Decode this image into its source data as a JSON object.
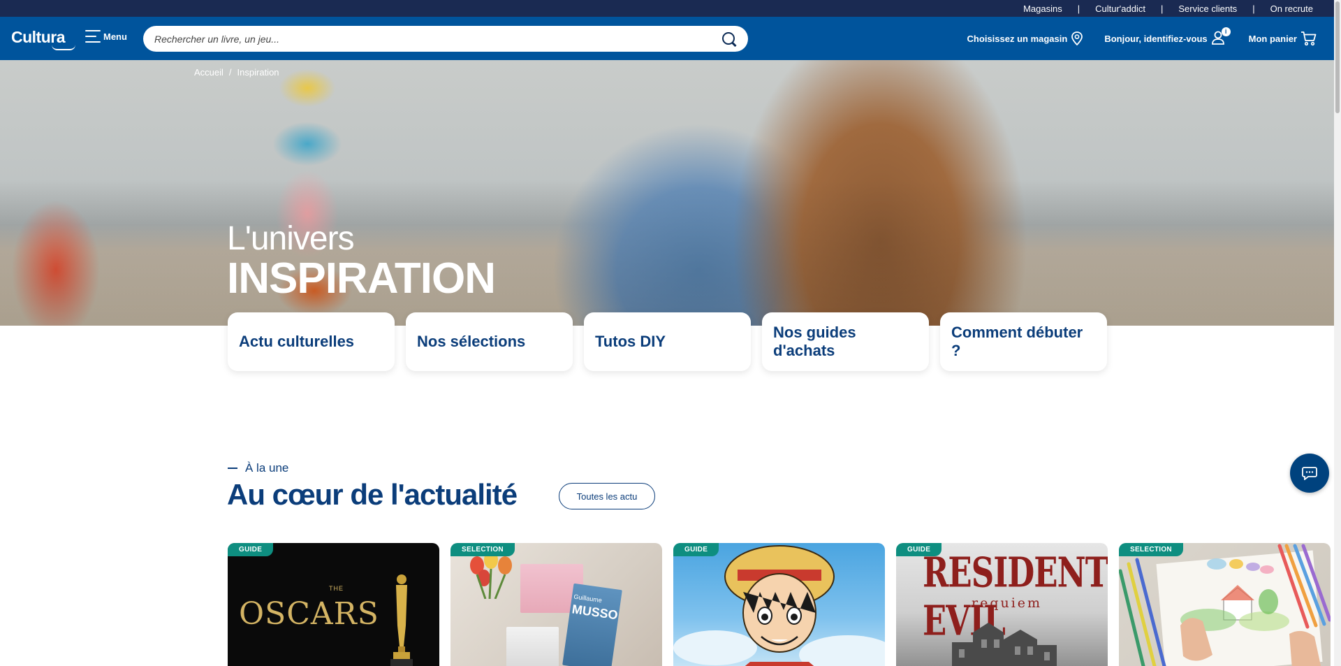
{
  "topbar": {
    "links": [
      "Magasins",
      "Cultur'addict",
      "Service clients",
      "On recrute"
    ],
    "separator": "|"
  },
  "header": {
    "logo_text": "Cultura",
    "menu_label": "Menu",
    "search_placeholder": "Rechercher un livre, un jeu...",
    "store_label": "Choisissez un magasin",
    "account_label": "Bonjour, identifiez-vous",
    "account_badge": "i",
    "cart_label": "Mon panier"
  },
  "hero": {
    "breadcrumb": [
      "Accueil",
      "Inspiration"
    ],
    "breadcrumb_separator": "/",
    "kicker": "L'univers",
    "title": "INSPIRATION"
  },
  "categories": [
    {
      "label": "Actu culturelles"
    },
    {
      "label": "Nos sélections"
    },
    {
      "label": "Tutos DIY"
    },
    {
      "label": "Nos guides d'achats"
    },
    {
      "label": "Comment débuter ?"
    }
  ],
  "section": {
    "kicker": "À la une",
    "title": "Au cœur de l'actualité",
    "see_all_label": "Toutes les actu"
  },
  "articles": [
    {
      "badge": "GUIDE",
      "image_text": "OSCARS",
      "image_small_text": "THE"
    },
    {
      "badge": "SELECTION",
      "image_text": "MUSSO",
      "image_small_text": "Guillaume"
    },
    {
      "badge": "GUIDE"
    },
    {
      "badge": "GUIDE",
      "image_text": "RESIDENT EVIL",
      "image_small_text": "requiem"
    },
    {
      "badge": "SELECTION"
    }
  ],
  "colors": {
    "topbar": "#1a2a52",
    "header": "#00549c",
    "brand_text": "#0b3d7a",
    "badge": "#0e8e80",
    "chat": "#00427e"
  },
  "icons": {
    "search": "search-icon",
    "store": "map-pin-icon",
    "account": "user-icon",
    "cart": "cart-icon",
    "menu": "hamburger-icon",
    "chat": "chat-bubble-icon"
  }
}
